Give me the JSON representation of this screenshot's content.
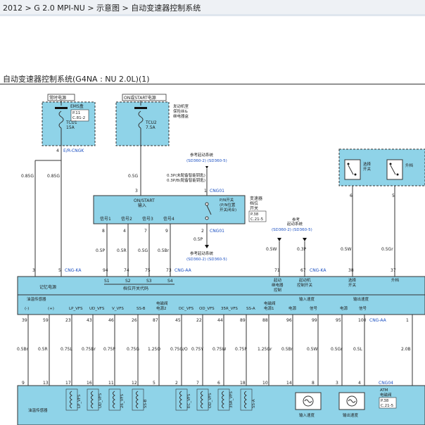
{
  "breadcrumb": "2012 > G 2.0 MPI-NU > 示意图 > 自动变速器控制系统",
  "diagram_title": "自动变速器控制系统(G4NA : NU 2.0L)(1)",
  "power": {
    "constant": "常时电源",
    "on_start": "ON或START电源",
    "ems_box": "EMS盒",
    "ems_ref": [
      "P.11",
      "C.81-2"
    ],
    "engine_box": [
      "发动机室",
      "保险丝&",
      "继电器盒"
    ],
    "fuse1": [
      "TCU1",
      "15A"
    ],
    "fuse2": [
      "TCU2",
      "7.5A"
    ],
    "ercngk": "E/R-CNGK"
  },
  "ref_start": [
    "参考起动系统",
    "(SD360-2) (SD360-5)"
  ],
  "ref_start2": [
    "参考起动系统",
    "(SD360-2) (SD360-5)"
  ],
  "ref_start3": [
    "参考",
    "起动系统",
    "(SD360-2) (SD360-5)"
  ],
  "notes": [
    "0.3P(未配备智能钥匙)",
    "0.3P/B(配备智能钥匙)"
  ],
  "inhibitor": {
    "label": [
      "ON/START",
      "输入"
    ],
    "name": [
      "变速器",
      "档位",
      "开关"
    ],
    "ref": [
      "P.38",
      "C.21-5"
    ],
    "pn": [
      "P/N开关",
      "(P/N位置",
      "开关闭合)"
    ],
    "signals": [
      "信号1",
      "信号2",
      "信号3",
      "信号4"
    ]
  },
  "shift": {
    "select": [
      "选择",
      "开关"
    ],
    "up": "升档"
  },
  "connectors": {
    "cng01": "CNG01",
    "cngka": "CNG-KA",
    "cngaa": "CNG-AA",
    "cng04": "CNG04"
  },
  "wires_top": {
    "w1": "0.85G",
    "w2": "0.85G",
    "w3": "0.5G",
    "w4": "0.5P",
    "s1": "0.5P",
    "s2": "0.5R",
    "s3": "0.5G",
    "s4": "0.5Br",
    "r1": "0.5W",
    "r2": "0.3P",
    "r3": "0.5W",
    "r4": "0.5Gr"
  },
  "pins_small": {
    "p4": "4",
    "p3": "3",
    "p1": "1",
    "p2": "2",
    "p8": "8",
    "p4b": "4",
    "p7": "7",
    "p9": "9",
    "p6": "6",
    "p5": "5"
  },
  "ecm_pins_top": [
    "3",
    "5",
    "94",
    "74",
    "75",
    "73",
    "71",
    "67",
    "38",
    "37"
  ],
  "ecm_labels_top": {
    "memory": "记忆电源",
    "s": [
      "S1",
      "S2",
      "S3",
      "S4"
    ],
    "code": "档位开关代码",
    "relay": [
      "起动",
      "继电器",
      "控制"
    ],
    "starter": [
      "起动机",
      "控制开关"
    ],
    "select": [
      "选择",
      "开关"
    ],
    "upshift": "升档"
  },
  "ecm_labels_bottom": {
    "oil_temp": "油温传感器",
    "minus": "(-)",
    "plus": "(+)",
    "vfs": [
      "LP_VFS",
      "UD_VFS",
      "V_VFS",
      "SS-B",
      "电磁阀",
      "电源2",
      "DC_VFS",
      "OD_VFS",
      "35R_VFS",
      "SS-A",
      "电磁阀",
      "电源1"
    ],
    "in_speed": "输入速度",
    "out_speed": "输出速度",
    "power": "电源",
    "signal": "信号"
  },
  "ecm_pins_bottom": [
    "39",
    "59",
    "23",
    "43",
    "46",
    "26",
    "87",
    "45",
    "22",
    "44",
    "89",
    "88",
    "96",
    "99",
    "95",
    "100",
    "1"
  ],
  "wires_bottom": [
    "0.5Br",
    "0.5R",
    "0.75L",
    "0.75Br",
    "0.75P",
    "0.75G",
    "1.25O",
    "0.75G/O",
    "0.75Y",
    "0.75W",
    "0.75P",
    "1.25Gr",
    "0.5Br",
    "0.5W",
    "0.5Gr",
    "0.5L",
    "2.0B"
  ],
  "atm_pins": [
    "9",
    "13",
    "17",
    "16",
    "11",
    "12",
    "5",
    "2",
    "7",
    "6",
    "18",
    "10",
    "14",
    "8",
    "3",
    "4"
  ],
  "atm": {
    "name": [
      "ATM",
      "电磁阀"
    ],
    "ref": [
      "P.38",
      "C.21-5"
    ],
    "oil_temp": "油温传感器",
    "solenoids": [
      "LP_VFS",
      "UD_VFS",
      "26_VFS",
      "SS-B",
      "EC_VFS",
      "OD_VFS",
      "35R_VFS",
      "SS-A"
    ],
    "in_speed": "输入速度",
    "out_speed": "输出速度"
  }
}
